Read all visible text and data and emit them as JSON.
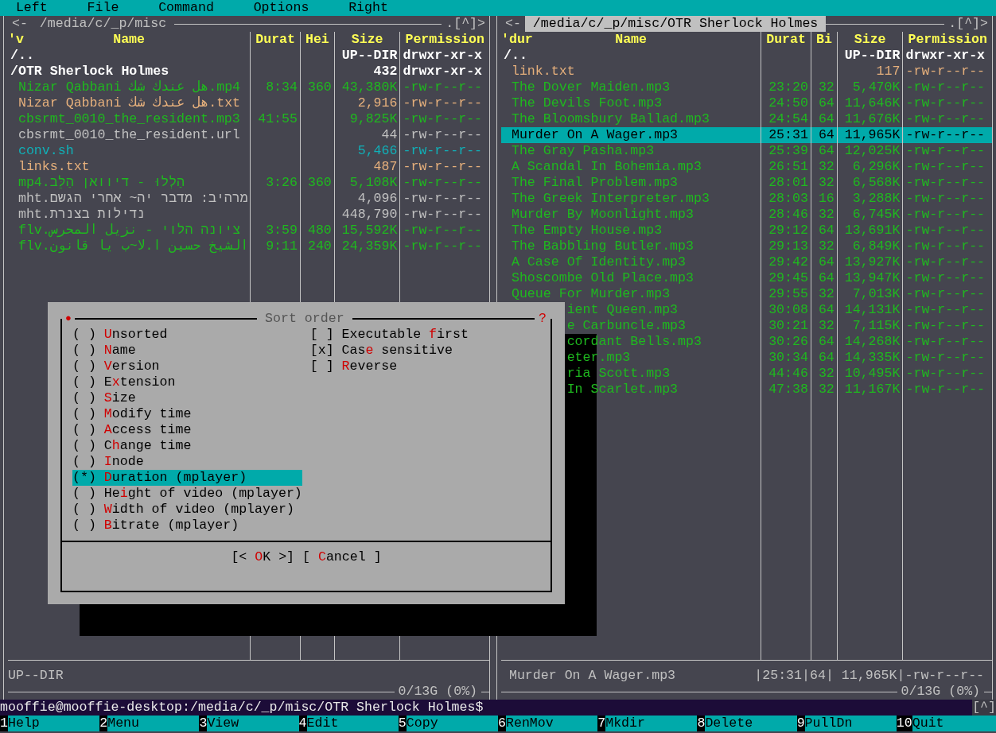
{
  "menu": [
    "Left",
    "File",
    "Command",
    "Options",
    "Right"
  ],
  "panels": [
    {
      "path": "/media/c/_p/misc",
      "active": false,
      "nav_left": "<-",
      "nav_right": ".[^]>",
      "sort_mark": "'v",
      "columns": [
        "Name",
        "Durat",
        "Hei",
        "Size",
        "Permission"
      ],
      "rows": [
        {
          "kind": "updir",
          "cells": [
            "/..",
            "",
            "",
            "UP--DIR",
            "drwxr-xr-x"
          ],
          "color": "#ffffff",
          "selected": false
        },
        {
          "kind": "dir",
          "cells": [
            "/OTR Sherlock Holmes",
            "",
            "",
            "432",
            "drwxr-xr-x"
          ],
          "color": "#ffffff",
          "selected": false
        },
        {
          "kind": "file",
          "cells": [
            "Nizar Qabbani هل عندك شك.mp4",
            "8:34",
            "360",
            "43,380K",
            "-rw-r--r--"
          ],
          "color": "#1fb81f",
          "selected": false
        },
        {
          "kind": "file",
          "cells": [
            "Nizar Qabbani هل عندك شك.txt",
            "",
            "",
            "2,916",
            "-rw-r--r--"
          ],
          "color": "#e6b07c",
          "selected": false
        },
        {
          "kind": "file",
          "cells": [
            "cbsrmt_0010_the_resident.mp3",
            "41:55",
            "",
            "9,825K",
            "-rw-r--r--"
          ],
          "color": "#1fb81f",
          "selected": false
        },
        {
          "kind": "file",
          "cells": [
            "cbsrmt_0010_the_resident.url",
            "",
            "",
            "44",
            "-rw-r--r--"
          ],
          "color": "#c0c0c0",
          "selected": false
        },
        {
          "kind": "file",
          "cells": [
            "conv.sh",
            "",
            "",
            "5,466",
            "-rw-r--r--"
          ],
          "color": "#10b0b8",
          "selected": false
        },
        {
          "kind": "file",
          "cells": [
            "links.txt",
            "",
            "",
            "487",
            "-rw-r--r--"
          ],
          "color": "#e6b07c",
          "selected": false
        },
        {
          "kind": "file",
          "cells": [
            "mp4.הַלְלוּ - דיוואן הַלֵּב",
            "3:26",
            "360",
            "5,108K",
            "-rw-r--r--"
          ],
          "color": "#1fb81f",
          "selected": false
        },
        {
          "kind": "file",
          "cells": [
            "mht.מרהיב: מדבר יה~ אחרי הגשם",
            "",
            "",
            "4,096",
            "-rw-r--r--"
          ],
          "color": "#c0c0c0",
          "selected": false
        },
        {
          "kind": "file",
          "cells": [
            "mht.נדילות בצנרת",
            "",
            "",
            "448,790",
            "-rw-r--r--"
          ],
          "color": "#c0c0c0",
          "selected": false
        },
        {
          "kind": "file",
          "cells": [
            "flv.ציונה הלוי - نزيل المحرس",
            "3:59",
            "480",
            "15,592K",
            "-rw-r--r--"
          ],
          "color": "#1fb81f",
          "selected": false
        },
        {
          "kind": "file",
          "cells": [
            "flv.الشيخ حسين ا.لا~ب يا قانون",
            "9:11",
            "240",
            "24,359K",
            "-rw-r--r--"
          ],
          "color": "#1fb81f",
          "selected": false
        }
      ],
      "status": "UP--DIR",
      "free": "0/13G (0%)"
    },
    {
      "path": "/media/c/_p/misc/OTR Sherlock Holmes",
      "active": true,
      "nav_left": "<-",
      "nav_right": ".[^]>",
      "sort_mark": "'dur",
      "columns": [
        "Name",
        "Durat",
        "Bi",
        "Size",
        "Permission"
      ],
      "rows": [
        {
          "kind": "updir",
          "cells": [
            "/..",
            "",
            "",
            "UP--DIR",
            "drwxr-xr-x"
          ],
          "color": "#ffffff",
          "selected": false,
          "covered": false
        },
        {
          "kind": "file",
          "cells": [
            "link.txt",
            "",
            "",
            "117",
            "-rw-r--r--"
          ],
          "color": "#e6b07c",
          "selected": false,
          "covered": false
        },
        {
          "kind": "file",
          "cells": [
            "The Dover Maiden.mp3",
            "23:20",
            "32",
            "5,470K",
            "-rw-r--r--"
          ],
          "color": "#1fb81f",
          "selected": false,
          "covered": false
        },
        {
          "kind": "file",
          "cells": [
            "The Devils Foot.mp3",
            "24:50",
            "64",
            "11,646K",
            "-rw-r--r--"
          ],
          "color": "#1fb81f",
          "selected": false,
          "covered": false
        },
        {
          "kind": "file",
          "cells": [
            "The Bloomsbury Ballad.mp3",
            "24:54",
            "64",
            "11,676K",
            "-rw-r--r--"
          ],
          "color": "#1fb81f",
          "selected": false,
          "covered": false
        },
        {
          "kind": "file",
          "cells": [
            "Murder On A Wager.mp3",
            "25:31",
            "64",
            "11,965K",
            "-rw-r--r--"
          ],
          "selected": true,
          "covered": false
        },
        {
          "kind": "file",
          "cells": [
            "The Gray Pasha.mp3",
            "25:39",
            "64",
            "12,025K",
            "-rw-r--r--"
          ],
          "color": "#1fb81f",
          "selected": false,
          "covered": false
        },
        {
          "kind": "file",
          "cells": [
            "A Scandal In Bohemia.mp3",
            "26:51",
            "32",
            "6,296K",
            "-rw-r--r--"
          ],
          "color": "#1fb81f",
          "selected": false,
          "covered": false
        },
        {
          "kind": "file",
          "cells": [
            "The Final Problem.mp3",
            "28:01",
            "32",
            "6,568K",
            "-rw-r--r--"
          ],
          "color": "#1fb81f",
          "selected": false,
          "covered": false
        },
        {
          "kind": "file",
          "cells": [
            "The Greek Interpreter.mp3",
            "28:03",
            "16",
            "3,288K",
            "-rw-r--r--"
          ],
          "color": "#1fb81f",
          "selected": false,
          "covered": false
        },
        {
          "kind": "file",
          "cells": [
            "Murder By Moonlight.mp3",
            "28:46",
            "32",
            "6,745K",
            "-rw-r--r--"
          ],
          "color": "#1fb81f",
          "selected": false,
          "covered": false
        },
        {
          "kind": "file",
          "cells": [
            "The Empty House.mp3",
            "29:12",
            "64",
            "13,691K",
            "-rw-r--r--"
          ],
          "color": "#1fb81f",
          "selected": false,
          "covered": false
        },
        {
          "kind": "file",
          "cells": [
            "The Babbling Butler.mp3",
            "29:13",
            "32",
            "6,849K",
            "-rw-r--r--"
          ],
          "color": "#1fb81f",
          "selected": false,
          "covered": false
        },
        {
          "kind": "file",
          "cells": [
            "A Case Of Identity.mp3",
            "29:42",
            "64",
            "13,927K",
            "-rw-r--r--"
          ],
          "color": "#1fb81f",
          "selected": false,
          "covered": false
        },
        {
          "kind": "file",
          "cells": [
            "Shoscombe Old Place.mp3",
            "29:45",
            "64",
            "13,947K",
            "-rw-r--r--"
          ],
          "color": "#1fb81f",
          "selected": false,
          "covered": false
        },
        {
          "kind": "file",
          "cells": [
            "Queue For Murder.mp3",
            "29:55",
            "32",
            "7,013K",
            "-rw-r--r--"
          ],
          "color": "#1fb81f",
          "selected": false,
          "covered": false
        },
        {
          "kind": "file",
          "cells": [
            "ient Queen.mp3",
            "30:08",
            "64",
            "14,131K",
            "-rw-r--r--"
          ],
          "color": "#1fb81f",
          "selected": false,
          "covered": true
        },
        {
          "kind": "file",
          "cells": [
            "e Carbuncle.mp3",
            "30:21",
            "32",
            "7,115K",
            "-rw-r--r--"
          ],
          "color": "#1fb81f",
          "selected": false,
          "covered": true
        },
        {
          "kind": "file",
          "cells": [
            "cordant Bells.mp3",
            "30:26",
            "64",
            "14,268K",
            "-rw-r--r--"
          ],
          "color": "#1fb81f",
          "selected": false,
          "covered": true
        },
        {
          "kind": "file",
          "cells": [
            "eter.mp3",
            "30:34",
            "64",
            "14,335K",
            "-rw-r--r--"
          ],
          "color": "#1fb81f",
          "selected": false,
          "covered": true
        },
        {
          "kind": "file",
          "cells": [
            "ria Scott.mp3",
            "44:46",
            "32",
            "10,495K",
            "-rw-r--r--"
          ],
          "color": "#1fb81f",
          "selected": false,
          "covered": true
        },
        {
          "kind": "file",
          "cells": [
            "In Scarlet.mp3",
            "47:38",
            "32",
            "11,167K",
            "-rw-r--r--"
          ],
          "color": "#1fb81f",
          "selected": false,
          "covered": true
        }
      ],
      "status": "Murder On A Wager.mp3",
      "status_info": "|25:31|64| 11,965K|-rw-r--r--",
      "free": "0/13G (0%)"
    }
  ],
  "dialog": {
    "title": "Sort order",
    "corner_mark": "●",
    "help": "?",
    "radio_glyphs": {
      "on": "(*)",
      "off": "( )"
    },
    "check_glyphs": {
      "on": "[x]",
      "off": "[ ]"
    },
    "options": [
      {
        "key": "U",
        "post": "nsorted",
        "selected": false
      },
      {
        "key": "N",
        "post": "ame",
        "selected": false
      },
      {
        "key": "V",
        "post": "ersion",
        "selected": false
      },
      {
        "pre": "E",
        "key": "x",
        "post": "tension",
        "selected": false
      },
      {
        "key": "S",
        "post": "ize",
        "selected": false
      },
      {
        "key": "M",
        "post": "odify time",
        "selected": false
      },
      {
        "key": "A",
        "post": "ccess time",
        "selected": false
      },
      {
        "pre": "C",
        "key": "h",
        "post": "ange time",
        "selected": false
      },
      {
        "key": "I",
        "post": "node",
        "selected": false
      },
      {
        "key": "D",
        "post": "uration (mplayer)",
        "selected": true
      },
      {
        "pre": "He",
        "key": "i",
        "post": "ght of video (mplayer)",
        "selected": false
      },
      {
        "key": "W",
        "post": "idth of video (mplayer)",
        "selected": false
      },
      {
        "key": "B",
        "post": "itrate (mplayer)",
        "selected": false
      }
    ],
    "checks": [
      {
        "pre": "Executable ",
        "key": "f",
        "post": "irst",
        "checked": false
      },
      {
        "pre": "Cas",
        "key": "e",
        "post": " sensitive",
        "checked": true
      },
      {
        "key": "R",
        "post": "everse",
        "checked": false
      }
    ],
    "buttons": [
      {
        "pre": "[< ",
        "key": "O",
        "post": "K >]"
      },
      {
        "pre": "[ ",
        "key": "C",
        "post": "ancel ]"
      }
    ]
  },
  "command_line": {
    "prompt": "mooffie@mooffie-desktop:/media/c/_p/misc/OTR Sherlock Holmes$",
    "indicator": "[^]"
  },
  "function_keys": [
    {
      "number": "1",
      "label": "Help"
    },
    {
      "number": "2",
      "label": "Menu"
    },
    {
      "number": "3",
      "label": "View"
    },
    {
      "number": "4",
      "label": "Edit"
    },
    {
      "number": "5",
      "label": "Copy"
    },
    {
      "number": "6",
      "label": "RenMov"
    },
    {
      "number": "7",
      "label": "Mkdir"
    },
    {
      "number": "8",
      "label": "Delete"
    },
    {
      "number": "9",
      "label": "PullDn"
    },
    {
      "number": "10",
      "label": "Quit"
    }
  ]
}
